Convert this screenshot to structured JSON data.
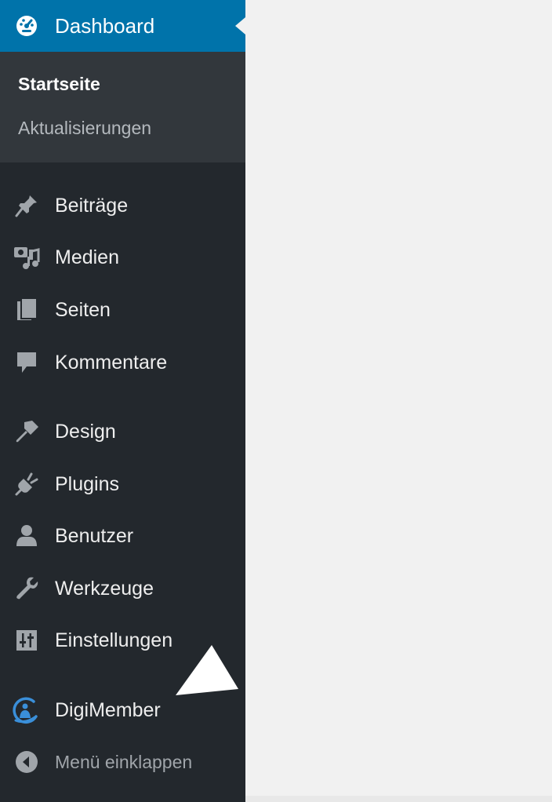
{
  "colors": {
    "sidebar_bg": "#23282d",
    "submenu_bg": "#32373c",
    "active_bg": "#0073aa",
    "icon": "#a0a5aa",
    "digimember_accent": "#3a8fd9",
    "content_bg": "#f1f1f1"
  },
  "menu": {
    "dashboard": {
      "label": "Dashboard",
      "icon": "dashboard-gauge-icon"
    },
    "submenu": [
      {
        "label": "Startseite"
      },
      {
        "label": "Aktualisierungen"
      }
    ],
    "items": [
      {
        "label": "Beiträge",
        "icon": "pushpin-icon"
      },
      {
        "label": "Medien",
        "icon": "media-icon"
      },
      {
        "label": "Seiten",
        "icon": "pages-icon"
      },
      {
        "label": "Kommentare",
        "icon": "comment-bubble-icon"
      },
      {
        "label": "Design",
        "icon": "paintbrush-icon"
      },
      {
        "label": "Plugins",
        "icon": "plug-icon"
      },
      {
        "label": "Benutzer",
        "icon": "user-icon"
      },
      {
        "label": "Werkzeuge",
        "icon": "wrench-icon"
      },
      {
        "label": "Einstellungen",
        "icon": "settings-sliders-icon"
      },
      {
        "label": "DigiMember",
        "icon": "digimember-logo-icon"
      }
    ],
    "collapse": {
      "label": "Menü einklappen",
      "icon": "collapse-arrow-icon"
    }
  }
}
